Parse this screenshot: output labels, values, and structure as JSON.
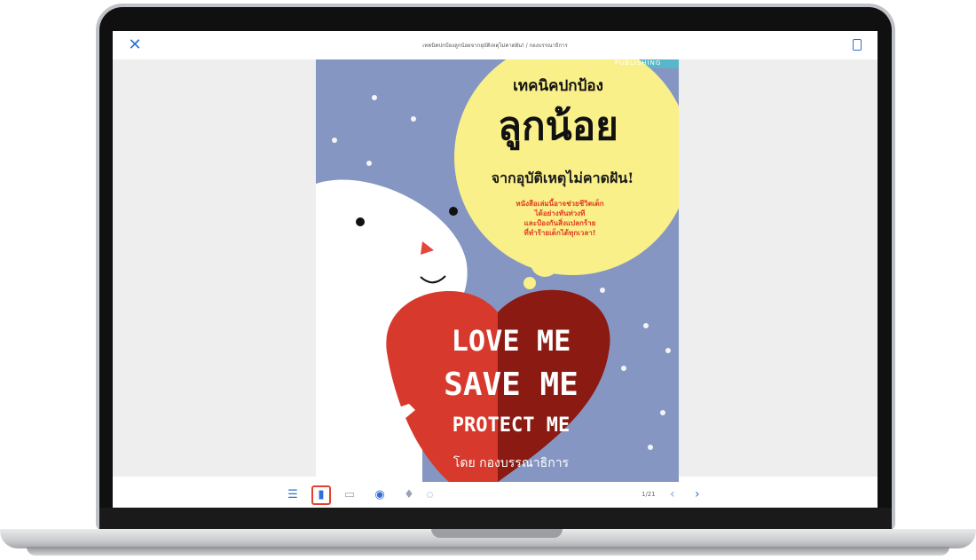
{
  "reader": {
    "title": "เทคนิคปกป้องลูกน้อยจากอุบัติเหตุไม่คาดฝัน! / กองบรรณาธิการ",
    "page_indicator": "1/21"
  },
  "cover": {
    "publisher_tag": "PUBLISHING",
    "heading_small": "เทคนิคปกป้อง",
    "heading_big": "ลูกน้อย",
    "heading_sub": "จากอุบัติเหตุไม่คาดฝัน!",
    "blurb_lines": [
      "หนังสือเล่มนี้อาจช่วยชีวิตเด็ก",
      "ได้อย่างทันท่วงที",
      "และป้องกันสิ่งแปลกร้าย",
      "ที่ทำร้ายเด็กได้ทุกเวลา!"
    ],
    "love": "LOVE ME",
    "save": "SAVE ME",
    "protect": "PROTECT ME",
    "author": "โดย กองบรรณาธิการ"
  },
  "colors": {
    "accent": "#2f6fd6",
    "active_outline": "#e2422c",
    "cover_bg": "#8596c3",
    "bubble": "#f9f08a",
    "heart_light": "#d73a2c",
    "heart_dark": "#8b1a12"
  },
  "icons": {
    "close": "close-icon",
    "bookmark": "bookmark-icon",
    "toc": "list-icon",
    "single_page": "single-page-icon",
    "double_page": "double-page-icon",
    "view_toggle": "eye-icon",
    "audio": "microphone-icon",
    "prev": "chevron-left-icon",
    "next": "chevron-right-icon"
  }
}
